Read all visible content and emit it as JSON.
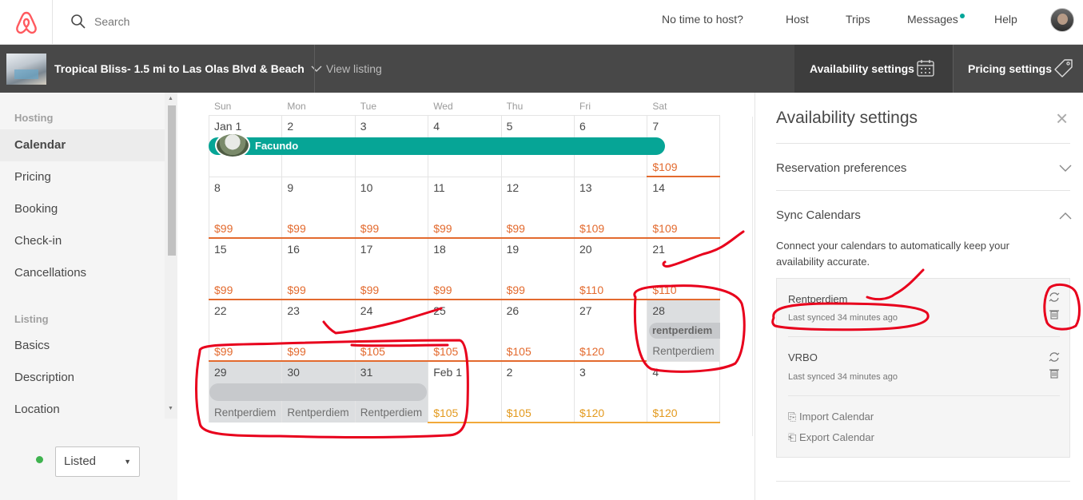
{
  "topnav": {
    "search_placeholder": "Search",
    "links": [
      "No time to host?",
      "Host",
      "Trips",
      "Messages",
      "Help"
    ]
  },
  "listing_bar": {
    "title": "Tropical Bliss- 1.5 mi to Las Olas Blvd & Beach",
    "view_listing": "View listing",
    "availability_settings": "Availability settings",
    "pricing_settings": "Pricing settings"
  },
  "sidebar": {
    "hosting_header": "Hosting",
    "hosting_items": [
      "Calendar",
      "Pricing",
      "Booking",
      "Check-in",
      "Cancellations"
    ],
    "listing_header": "Listing",
    "listing_items": [
      "Basics",
      "Description",
      "Location"
    ],
    "status": "Listed"
  },
  "calendar": {
    "weekdays": [
      "Sun",
      "Mon",
      "Tue",
      "Wed",
      "Thu",
      "Fri",
      "Sat"
    ],
    "weeks": [
      {
        "days": [
          "Jan 1",
          "2",
          "3",
          "4",
          "5",
          "6",
          "7"
        ],
        "prices": [
          "",
          "",
          "",
          "",
          "",
          "",
          "$109"
        ]
      },
      {
        "days": [
          "8",
          "9",
          "10",
          "11",
          "12",
          "13",
          "14"
        ],
        "prices": [
          "$99",
          "$99",
          "$99",
          "$99",
          "$99",
          "$109",
          "$109"
        ]
      },
      {
        "days": [
          "15",
          "16",
          "17",
          "18",
          "19",
          "20",
          "21"
        ],
        "prices": [
          "$99",
          "$99",
          "$99",
          "$99",
          "$99",
          "$110",
          "$110"
        ]
      },
      {
        "days": [
          "22",
          "23",
          "24",
          "25",
          "26",
          "27",
          "28"
        ],
        "prices": [
          "$99",
          "$99",
          "$105",
          "$105",
          "$105",
          "$120",
          ""
        ]
      },
      {
        "days": [
          "29",
          "30",
          "31",
          "Feb 1",
          "2",
          "3",
          "4"
        ],
        "prices": [
          "",
          "",
          "",
          "$105",
          "$105",
          "$120",
          "$120"
        ]
      }
    ],
    "booking_guest": "Facundo",
    "block_label": "Rentperdiem",
    "block_tag": "rentperdiem"
  },
  "panel": {
    "title": "Availability settings",
    "reservation_prefs": "Reservation preferences",
    "sync_calendars": "Sync Calendars",
    "sync_description": "Connect your calendars to automatically keep your availability accurate.",
    "calendars": [
      {
        "name": "Rentperdiem",
        "last_synced": "Last synced 34 minutes ago"
      },
      {
        "name": "VRBO",
        "last_synced": "Last synced 34 minutes ago"
      }
    ],
    "import_label": "Import Calendar",
    "export_label": "Export Calendar"
  },
  "colors": {
    "accent_teal": "#06a596",
    "price_orange": "#e36a2e",
    "annotation_red": "#e8001c"
  }
}
